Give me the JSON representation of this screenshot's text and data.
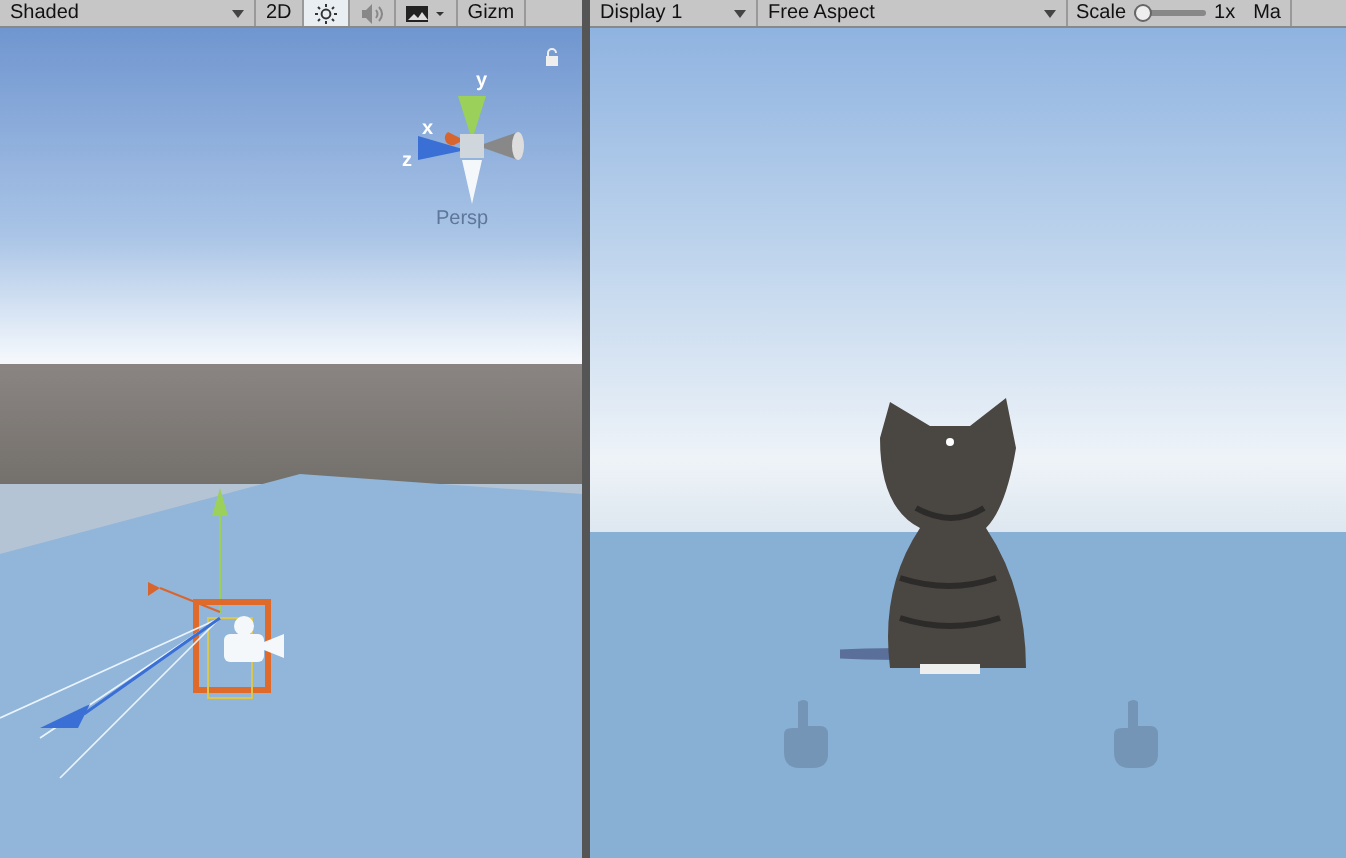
{
  "scene_toolbar": {
    "draw_mode": "Shaded",
    "toggles": [
      {
        "kind": "text",
        "label": "2D",
        "selected": false
      },
      {
        "kind": "light",
        "selected": true
      },
      {
        "kind": "audio",
        "selected": false
      },
      {
        "kind": "effects",
        "selected": false
      }
    ],
    "gizmos_label": "Gizm"
  },
  "scene_view": {
    "axes": [
      {
        "kind": "y",
        "label": "y"
      },
      {
        "kind": "x",
        "label": "x"
      },
      {
        "kind": "z",
        "label": "z"
      }
    ],
    "projection": "Persp"
  },
  "game_toolbar": {
    "display": "Display 1",
    "aspect": "Free Aspect",
    "scale_label": "Scale",
    "scale": {
      "level": 0.1
    },
    "scale_value": "1x",
    "next_label": "Ma"
  }
}
